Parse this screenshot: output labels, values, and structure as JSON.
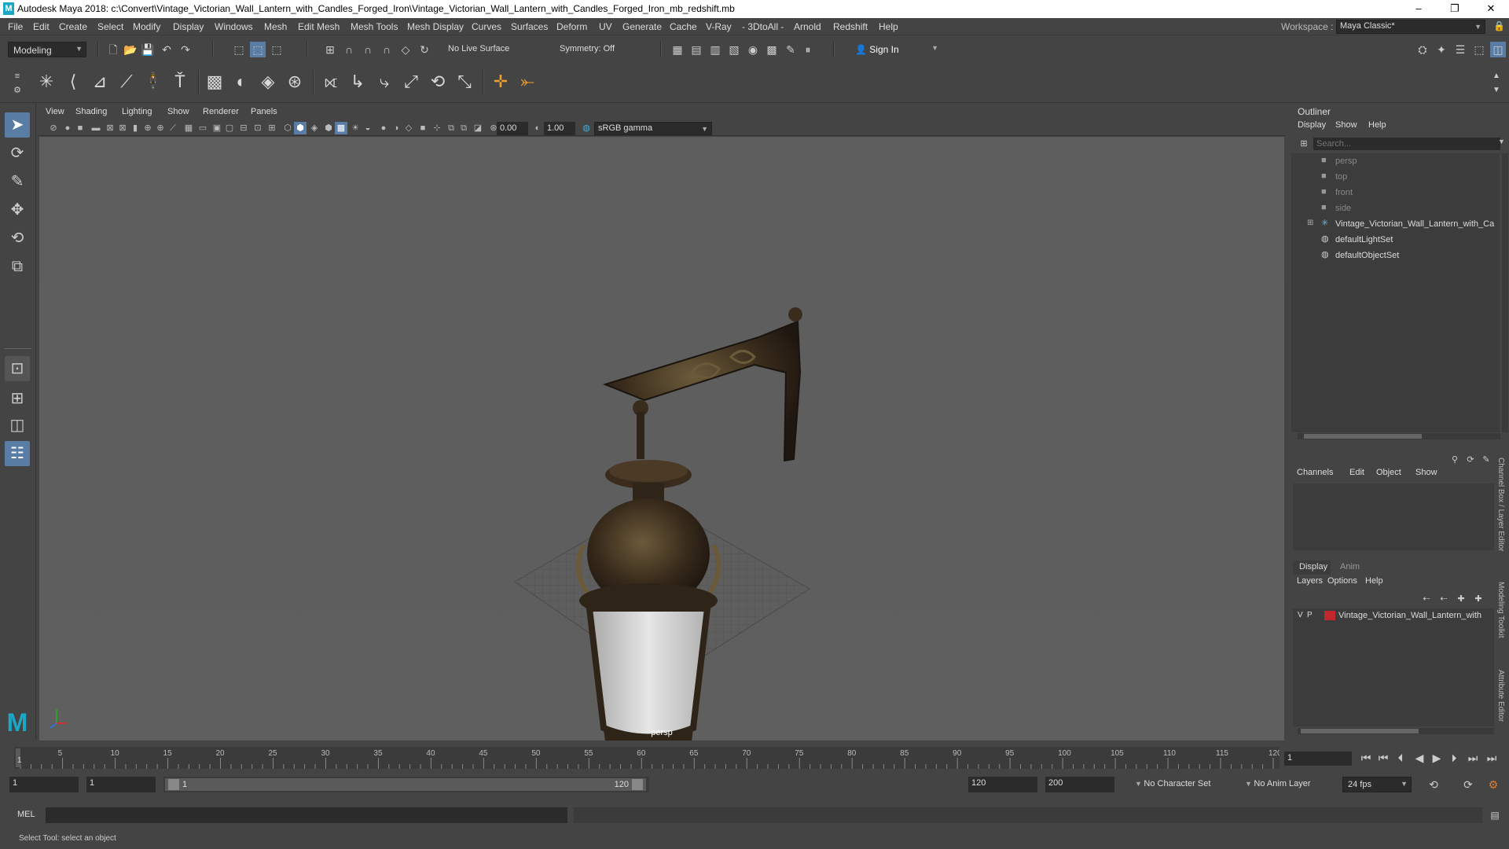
{
  "app": {
    "title": "Autodesk Maya 2018: c:\\Convert\\Vintage_Victorian_Wall_Lantern_with_Candles_Forged_Iron\\Vintage_Victorian_Wall_Lantern_with_Candles_Forged_Iron_mb_redshift.mb",
    "logo": "M",
    "win_minimize": "–",
    "win_maximize": "❐",
    "win_close": "✕"
  },
  "menus": [
    "File",
    "Edit",
    "Create",
    "Select",
    "Modify",
    "Display",
    "Windows",
    "Mesh",
    "Edit Mesh",
    "Mesh Tools",
    "Mesh Display",
    "Curves",
    "Surfaces",
    "Deform",
    "UV",
    "Generate",
    "Cache",
    "V-Ray",
    "- 3DtoAll -",
    "Arnold",
    "Redshift",
    "Help"
  ],
  "workspace": {
    "label": "Workspace :",
    "value": "Maya Classic*"
  },
  "status": {
    "mode": "Modeling",
    "live_surface": "No Live Surface",
    "symmetry": "Symmetry: Off",
    "sign_in": "Sign In"
  },
  "viewport": {
    "menus": [
      "View",
      "Shading",
      "Lighting",
      "Show",
      "Renderer",
      "Panels"
    ],
    "exposure": "0.00",
    "gamma": "1.00",
    "colorspace": "sRGB gamma",
    "camera_label": "persp"
  },
  "outliner": {
    "title": "Outliner",
    "menus": [
      "Display",
      "Show",
      "Help"
    ],
    "search_placeholder": "Search...",
    "items": [
      {
        "label": "persp",
        "type": "camera",
        "dim": true
      },
      {
        "label": "top",
        "type": "camera",
        "dim": true
      },
      {
        "label": "front",
        "type": "camera",
        "dim": true
      },
      {
        "label": "side",
        "type": "camera",
        "dim": true
      },
      {
        "label": "Vintage_Victorian_Wall_Lantern_with_Ca",
        "type": "group",
        "dim": false
      },
      {
        "label": "defaultLightSet",
        "type": "set",
        "dim": false
      },
      {
        "label": "defaultObjectSet",
        "type": "set",
        "dim": false
      }
    ]
  },
  "channelbox": {
    "menus": [
      "Channels",
      "Edit",
      "Object",
      "Show"
    ]
  },
  "layereditor": {
    "tabs": [
      "Display",
      "Anim"
    ],
    "menus": [
      "Layers",
      "Options",
      "Help"
    ],
    "layer": {
      "v": "V",
      "p": "P",
      "name": "Vintage_Victorian_Wall_Lantern_with",
      "color": "#c1272d"
    }
  },
  "sidetabs": [
    "Channel Box / Layer Editor",
    "Modeling Toolkit",
    "Attribute Editor"
  ],
  "timeline": {
    "ticks": [
      "5",
      "10",
      "15",
      "20",
      "25",
      "30",
      "35",
      "40",
      "45",
      "50",
      "55",
      "60",
      "65",
      "70",
      "75",
      "80",
      "85",
      "90",
      "95",
      "100",
      "105",
      "110",
      "115",
      "120"
    ],
    "start_marker": "1",
    "current_frame": "1"
  },
  "range": {
    "start": "1",
    "inner_start": "1",
    "slider_start": "1",
    "slider_end": "120",
    "end": "120",
    "max_end": "200",
    "character_set": "No Character Set",
    "anim_layer": "No Anim Layer",
    "fps": "24 fps"
  },
  "cmd": {
    "label": "MEL"
  },
  "help": {
    "text": "Select Tool: select an object"
  }
}
